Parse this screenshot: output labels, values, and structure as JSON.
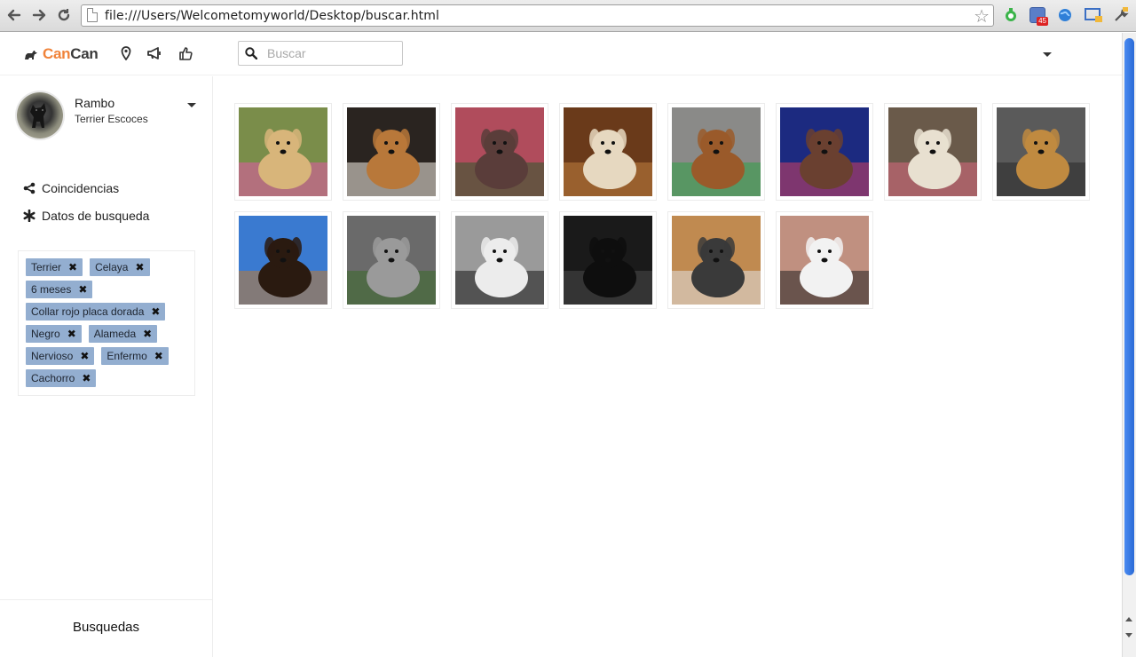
{
  "browser": {
    "url": "file:///Users/Welcometomyworld/Desktop/buscar.html",
    "badge_count": "45"
  },
  "header": {
    "brand_part1": "Can",
    "brand_part2": "Can",
    "brand_color": "#f0833a",
    "search_placeholder": "Buscar",
    "icons": [
      "map-marker-icon",
      "megaphone-icon",
      "thumbs-up-icon"
    ]
  },
  "profile": {
    "name": "Rambo",
    "breed": "Terrier Escoces"
  },
  "sidebar": {
    "nav": [
      {
        "label": "Coincidencias",
        "icon": "share-icon"
      },
      {
        "label": "Datos de busqueda",
        "icon": "asterisk-icon"
      }
    ],
    "tag_rows": [
      [
        "Terrier",
        "Celaya"
      ],
      [
        "6 meses"
      ],
      [
        "Collar rojo placa dorada"
      ],
      [
        "Negro",
        "Alameda"
      ],
      [
        "Nervioso",
        "Enfermo"
      ],
      [
        "Cachorro"
      ]
    ],
    "tag_color": "#93aed0",
    "footer_label": "Busquedas"
  },
  "results": {
    "photos": [
      "dog-photo-yellow-lab-with-child",
      "dog-photo-beagle",
      "dog-photo-brown-pitbull",
      "dog-photo-cream-poodle",
      "dog-photo-dachshund-in-cage",
      "dog-photo-small-brown-dog",
      "dog-photo-white-terrier",
      "dog-photo-golden-retriever",
      "dog-photo-black-tan-pinscher",
      "dog-photo-husky-on-sidewalk",
      "dog-photo-black-white-mutt",
      "dog-photo-black-dog",
      "dog-photo-schnauzer",
      "dog-photo-chihuahua-in-box"
    ]
  }
}
